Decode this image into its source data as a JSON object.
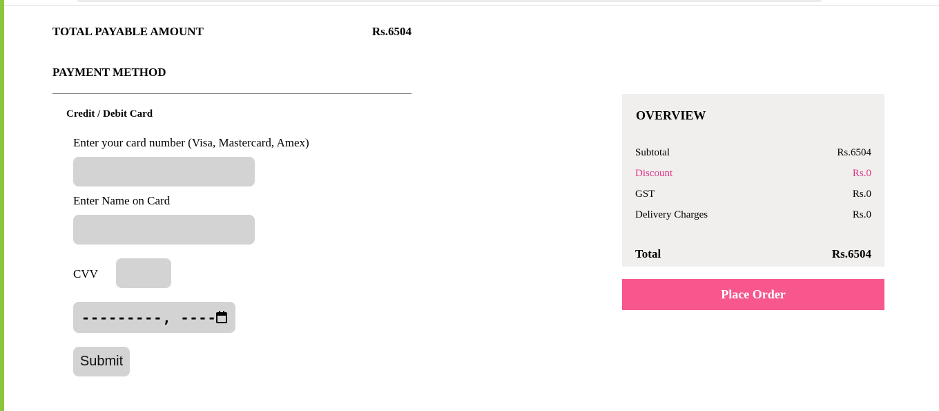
{
  "summary": {
    "total_payable_label": "TOTAL PAYABLE AMOUNT",
    "total_payable_value": "Rs.6504",
    "payment_method_label": "PAYMENT METHOD"
  },
  "card_form": {
    "title": "Credit / Debit Card",
    "card_number_label": "Enter your card number (Visa, Mastercard, Amex)",
    "card_number_value": "",
    "name_label": "Enter Name on Card",
    "name_value": "",
    "cvv_label": "CVV",
    "cvv_value": "",
    "expiry_display": "---------, ----",
    "submit_label": "Submit"
  },
  "overview": {
    "title": "OVERVIEW",
    "rows": [
      {
        "label": "Subtotal",
        "value": "Rs.6504"
      },
      {
        "label": "Discount",
        "value": "Rs.0"
      },
      {
        "label": "GST",
        "value": "Rs.0"
      },
      {
        "label": "Delivery Charges",
        "value": "Rs.0"
      }
    ],
    "total_label": "Total",
    "total_value": "Rs.6504",
    "place_order_label": "Place Order"
  },
  "icons": {
    "expiry_picker": "calendar-icon"
  },
  "colors": {
    "accent_green": "#8cc63f",
    "place_order_bg": "#f7578c",
    "discount_text": "#e0358a",
    "overview_bg": "#f0efed",
    "field_bg": "#d3d3d3"
  }
}
